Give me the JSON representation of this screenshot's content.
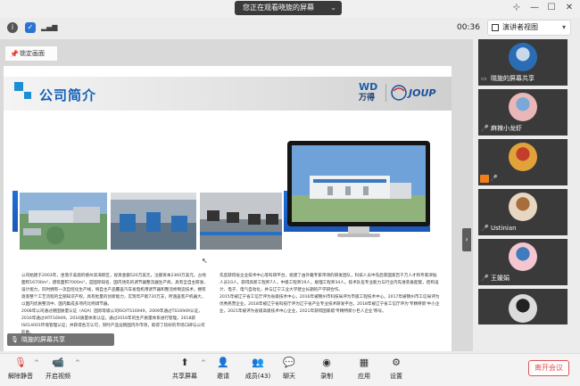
{
  "titlebar": {
    "share_notice": "您正在观看晓旎的屏幕",
    "chevron": "⌄",
    "pin": "⊹",
    "minimize": "—",
    "maximize": "☐",
    "close": "✕"
  },
  "toolbar": {
    "timer": "00:36",
    "view_label": "演讲者视图",
    "view_caret": "▾"
  },
  "share": {
    "lock_label": "锁定画面",
    "sharer_overlay": "晓旎的屏幕共享",
    "collapse": "›"
  },
  "slide": {
    "title": "公司简介",
    "logo_letters": "WD",
    "logo_cn": "万得",
    "logo_brand": "JOUP",
    "left_paragraphs": [
      "公司始建于2003年，坐落于美丽的德州滨海新区，投资金额520万美元，注册资本2360万美元，占地面积16700m²，建筑面积7000m²，是国际知名、国内领先的调节器整流器生产商，具有全自主研发、设计能力，同时拥有一流自控化生产线，将自主产品覆盖汽车发电机用调节器和整流桥制造技术，拥有逐渐整个工艺流程的全部知识产权，具有批量的创新能力，实现年产能720万支，所涵盖客户机器大，以国内优质整流中、国内集成多项内比例调节器。",
      "2008年公司通过德国质量认证（AQA）国际等级公司ISO/TS16949，2009年通过TS16949认证，2016年通过IATF16949，2016质量体系认证，通过2016年的生产质量体系进行管理，2018获IS014001环境管理认证；并获得各方认可，同时产品远销国内外市场，取得了较好的市场口碑与公司形象。"
    ],
    "right_paragraphs": [
      "先后获得省企业技术中心等科研平台，组建了由外籍专家带领的研发团队，科技人员中先后获国家百千万人才和专家津贴人员10人，获得高新工程师7人，中级工程师19人，助理工程师34人。技术队伍专业能力与行业内先进装备配套，结构设计、电子、电气自动化，并与辽宁工业大学建立长期的产学研合作。",
      "2015年被辽宁省工信厅评为省级技术中心，2016年被锦州市科技局评为市级工程技术中心，2017年被锦州市工信局评为优秀民营企业，2018年被辽宁省科技厅评为辽宁省产业专业技术研发平台，2018年被辽宁省工信厅评为'专精特新'中小企业，2021年被评为省级高级技术中心企业，2021年获得国家级'专精特新小巨人企业'称号。"
    ]
  },
  "participants": [
    {
      "name": "晓旎的屏幕共享",
      "color": "#2a6db5",
      "accent": "#c9d8ea"
    },
    {
      "name": "麻辣小龙虾",
      "color": "#e9b7b7",
      "accent": "#7aa8d8"
    },
    {
      "name": "-",
      "color": "#e2a23a",
      "accent": "#c33d2b"
    },
    {
      "name": "Ustinian",
      "color": "#e7d7c2",
      "accent": "#a86d3a"
    },
    {
      "name": "王媛娟",
      "color": "#f4c6cf",
      "accent": "#3e7bbf"
    },
    {
      "name": "",
      "color": "#dcdcdc",
      "accent": "#222"
    }
  ],
  "bottombar": {
    "unmute": "解除静音",
    "video": "开启视频",
    "share": "共享屏幕",
    "invite": "邀请",
    "members": "成员(43)",
    "chat": "聊天",
    "record": "录制",
    "apps": "应用",
    "settings": "设置",
    "leave": "离开会议",
    "caret": "^"
  },
  "colors": {
    "accent_blue": "#1b8fd6",
    "title_blue": "#1160b5",
    "leave_red": "#e05252"
  }
}
